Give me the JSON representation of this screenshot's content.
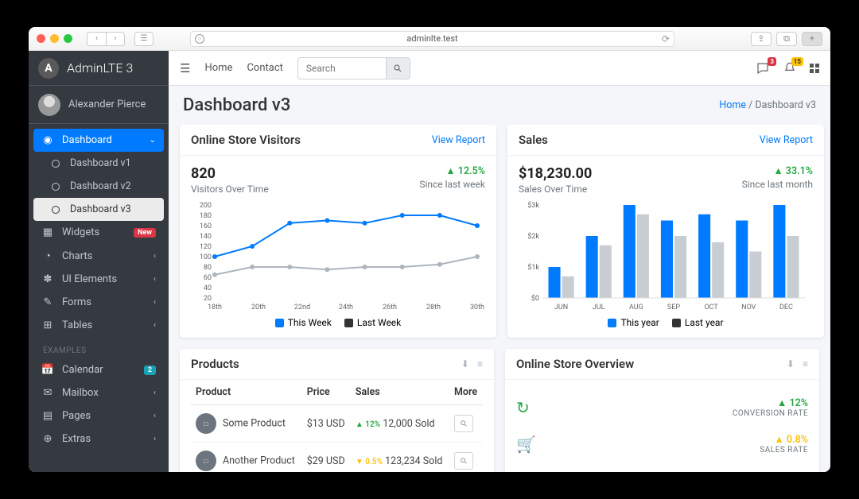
{
  "browser": {
    "url": "adminlte.test"
  },
  "brand": {
    "name": "AdminLTE 3",
    "logoLetter": "A"
  },
  "user": {
    "name": "Alexander Pierce"
  },
  "sidebar": {
    "dashboard": "Dashboard",
    "subs": [
      "Dashboard v1",
      "Dashboard v2",
      "Dashboard v3"
    ],
    "items": [
      {
        "label": "Widgets",
        "badge": "New",
        "badgeClass": ""
      },
      {
        "label": "Charts"
      },
      {
        "label": "UI Elements"
      },
      {
        "label": "Forms"
      },
      {
        "label": "Tables"
      }
    ],
    "examplesHeader": "EXAMPLES",
    "examples": [
      {
        "label": "Calendar",
        "badge": "2",
        "badgeClass": "blue"
      },
      {
        "label": "Mailbox"
      },
      {
        "label": "Pages"
      },
      {
        "label": "Extras"
      }
    ]
  },
  "topnav": {
    "home": "Home",
    "contact": "Contact",
    "searchPlaceholder": "Search",
    "chatBadge": "3",
    "bellBadge": "15"
  },
  "header": {
    "title": "Dashboard v3",
    "crumbHome": "Home",
    "crumbCurrent": "Dashboard v3"
  },
  "visitorsCard": {
    "title": "Online Store Visitors",
    "link": "View Report",
    "value": "820",
    "subtitle": "Visitors Over Time",
    "delta": "12.5%",
    "since": "Since last week",
    "legend1": "This Week",
    "legend2": "Last Week"
  },
  "salesCard": {
    "title": "Sales",
    "link": "View Report",
    "value": "$18,230.00",
    "subtitle": "Sales Over Time",
    "delta": "33.1%",
    "since": "Since last month",
    "legend1": "This year",
    "legend2": "Last year"
  },
  "productsCard": {
    "title": "Products",
    "cols": [
      "Product",
      "Price",
      "Sales",
      "More"
    ],
    "rows": [
      {
        "name": "Some Product",
        "price": "$13 USD",
        "deltaDir": "up",
        "delta": "12%",
        "sold": "12,000 Sold"
      },
      {
        "name": "Another Product",
        "price": "$29 USD",
        "deltaDir": "warn",
        "delta": "0.5%",
        "sold": "123,234 Sold"
      }
    ]
  },
  "overviewCard": {
    "title": "Online Store Overview",
    "rows": [
      {
        "iconColor": "#28a745",
        "delta": "12%",
        "dir": "up",
        "label": "CONVERSION RATE"
      },
      {
        "iconColor": "#ffc107",
        "delta": "0.8%",
        "dir": "warn",
        "label": "SALES RATE"
      }
    ]
  },
  "chart_data": [
    {
      "type": "line",
      "categories": [
        "18th",
        "20th",
        "22nd",
        "24th",
        "26th",
        "28th",
        "30th"
      ],
      "series": [
        {
          "name": "This Week",
          "values": [
            100,
            120,
            165,
            170,
            165,
            180,
            180,
            160
          ]
        },
        {
          "name": "Last Week",
          "values": [
            65,
            80,
            80,
            75,
            80,
            80,
            85,
            100
          ]
        }
      ],
      "ylim": [
        20,
        200
      ],
      "yticks": [
        20,
        40,
        60,
        80,
        100,
        120,
        140,
        160,
        180,
        200
      ]
    },
    {
      "type": "bar",
      "categories": [
        "JUN",
        "JUL",
        "AUG",
        "SEP",
        "OCT",
        "NOV",
        "DEC"
      ],
      "series": [
        {
          "name": "This year",
          "values": [
            1000,
            2000,
            3000,
            2500,
            2700,
            2500,
            3000
          ]
        },
        {
          "name": "Last year",
          "values": [
            700,
            1700,
            2700,
            2000,
            1800,
            1500,
            2000
          ]
        }
      ],
      "ylim": [
        0,
        3000
      ],
      "yticks": [
        "$0",
        "$1k",
        "$2k",
        "$3k"
      ]
    }
  ]
}
